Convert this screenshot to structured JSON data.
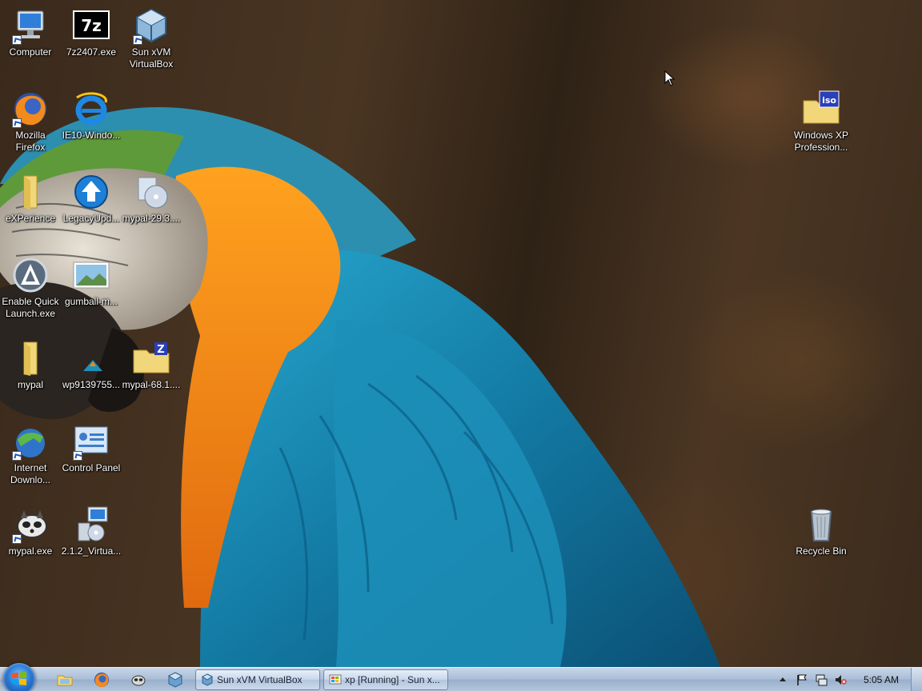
{
  "desktop": {
    "icons": [
      {
        "label": "Computer",
        "icon": "computer-icon",
        "shortcut": true
      },
      {
        "label": "7z2407.exe",
        "icon": "7zip-icon",
        "shortcut": false
      },
      {
        "label": "Sun xVM VirtualBox",
        "icon": "virtualbox-icon",
        "shortcut": true
      },
      {
        "label": "Mozilla Firefox",
        "icon": "firefox-icon",
        "shortcut": true
      },
      {
        "label": "IE10-Windo...",
        "icon": "internet-explorer-icon",
        "shortcut": false
      },
      {
        "label": "eXPerience",
        "icon": "folder-icon",
        "shortcut": false
      },
      {
        "label": "LegacyUpd...",
        "icon": "legacy-update-icon",
        "shortcut": false
      },
      {
        "label": "mypal-29.3....",
        "icon": "installer-cd-icon",
        "shortcut": false
      },
      {
        "label": "Enable Quick Launch.exe",
        "icon": "quick-launch-icon",
        "shortcut": false
      },
      {
        "label": "gumball-m...",
        "icon": "image-file-icon",
        "shortcut": false
      },
      {
        "label": "mypal",
        "icon": "folder-icon",
        "shortcut": false
      },
      {
        "label": "wp9139755...",
        "icon": "image-file-icon",
        "shortcut": false
      },
      {
        "label": "mypal-68.1....",
        "icon": "zip-folder-icon",
        "shortcut": false
      },
      {
        "label": "Internet Downlo...",
        "icon": "internet-download-manager-icon",
        "shortcut": true
      },
      {
        "label": "Control Panel",
        "icon": "control-panel-icon",
        "shortcut": true
      },
      {
        "label": "mypal.exe",
        "icon": "mypal-raccoon-icon",
        "shortcut": true
      },
      {
        "label": "2.1.2_Virtua...",
        "icon": "setup-installer-icon",
        "shortcut": false
      },
      {
        "label": "Windows XP Profession...",
        "icon": "iso-file-icon",
        "shortcut": false
      },
      {
        "label": "Recycle Bin",
        "icon": "recycle-bin-icon",
        "shortcut": false
      }
    ]
  },
  "taskbar": {
    "start": "start-orb-icon",
    "quick_launch": [
      "explorer-folder-icon",
      "firefox-icon",
      "mypal-icon",
      "virtualbox-icon"
    ],
    "tasks": [
      {
        "label": "Sun xVM VirtualBox",
        "icon": "virtualbox-icon"
      },
      {
        "label": "xp [Running] - Sun x...",
        "icon": "vm-running-icon"
      }
    ],
    "tray_icons": [
      "show-hidden-icons-arrow",
      "action-center-flag-icon",
      "network-icon",
      "volume-muted-icon"
    ],
    "clock": "5:05 AM"
  },
  "colors": {
    "taskbar": "#a9bdd6",
    "desktop_bg": "#3a2a1c",
    "parrot_blue": "#1e90b8",
    "parrot_orange": "#f08a1a"
  }
}
